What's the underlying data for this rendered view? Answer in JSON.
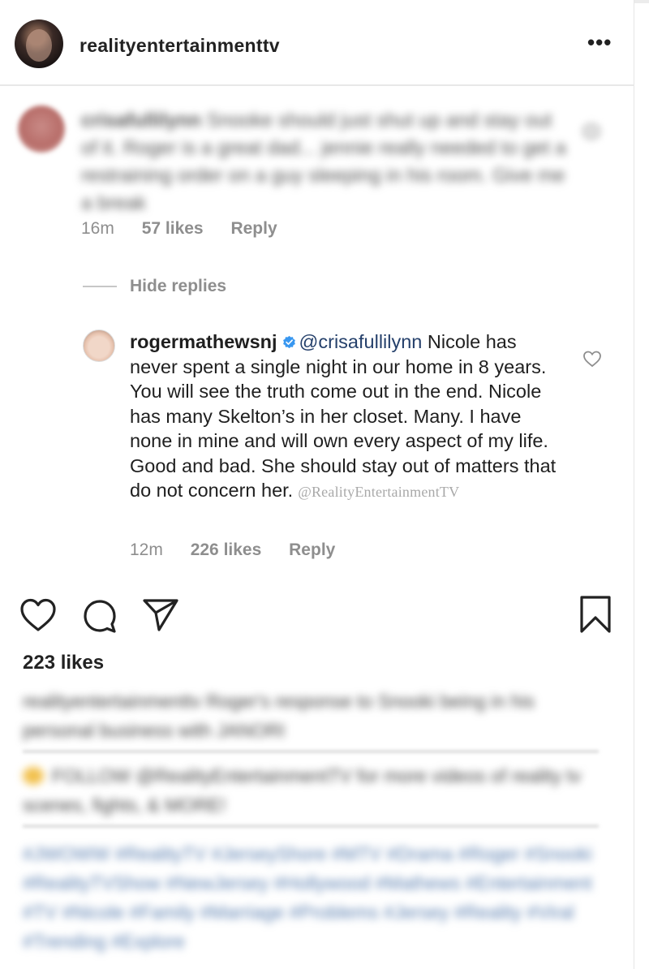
{
  "post": {
    "username": "realityentertainmenttv",
    "more_label": "•••"
  },
  "comment": {
    "username": "crisafullilynn",
    "text": "Snooke should just shut up and stay out of it. Roger is a great dad... jennie really needed to get a restraining order on a guy sleeping in his room. Give me a break",
    "time": "16m",
    "likes": "57 likes",
    "reply_label": "Reply",
    "hide_replies": "Hide replies"
  },
  "reply": {
    "username": "rogermathewsnj",
    "mention": "@crisafullilynn",
    "text": "Nicole has never spent a single night in our home in 8 years. You will see the truth come out in the end. Nicole has many Skelton’s in her closet. Many. I have none in mine and will own every aspect of my life. Good and bad. She should stay out of matters that do not concern her.",
    "watermark": "@RealityEntertainmentTV",
    "time": "12m",
    "likes": "226 likes",
    "reply_label": "Reply"
  },
  "actions": {
    "icons": [
      "heart-icon",
      "comment-icon",
      "share-icon",
      "bookmark-icon"
    ]
  },
  "likes_count": "223 likes",
  "caption": {
    "line1": "realityentertainmenttv Roger's response to Snooki being in his personal business with JANORI",
    "line2": "FOLLOW @RealityEntertainmentTV for more videos of reality tv scenes, fights, & MORE!",
    "hashtags": "#JWOWW #RealityTV #JerseyShore #MTV #Drama #Roger #Snooki #RealityTVShow #NewJersey #Hollywood #Mathews #Entertainment #TV #Nicole #Family #Marriage #Problems #Jersey #Reality #Viral #Trending #Explore"
  },
  "colors": {
    "verified": "#3897f0",
    "mention": "#25406b",
    "meta": "#8e8e8e"
  }
}
